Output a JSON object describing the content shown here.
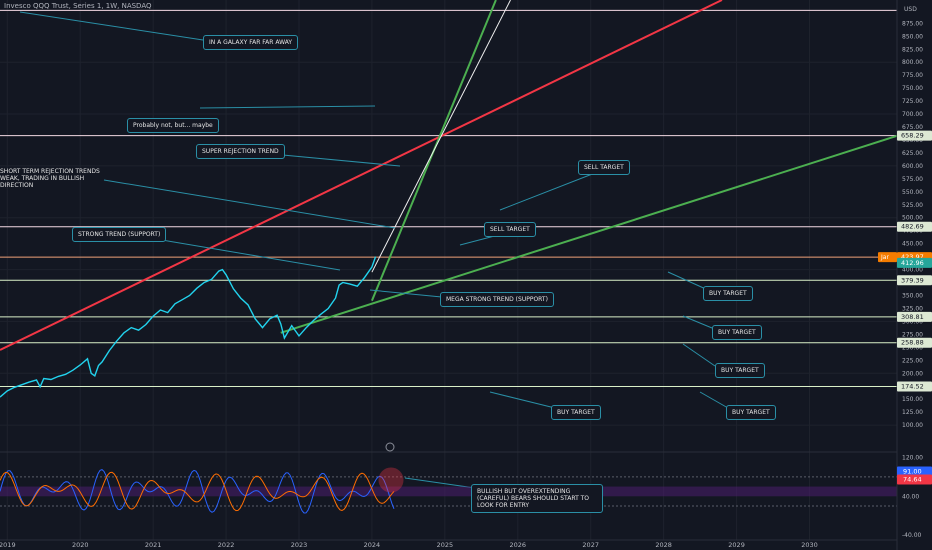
{
  "header": {
    "title": "Invesco QQQ Trust, Series 1, 1W, NASDAQ",
    "currency": "USD"
  },
  "chart_data": {
    "type": "line",
    "title": "Invesco QQQ Trust, Series 1, 1W, NASDAQ",
    "xlabel": "",
    "ylabel": "USD",
    "xlim": [
      2018.9,
      2031.2
    ],
    "ylim": [
      52,
      920
    ],
    "x_ticks": [
      "2019",
      "2020",
      "2021",
      "2022",
      "2023",
      "2024",
      "2025",
      "2026",
      "2027",
      "2028",
      "2029",
      "2030"
    ],
    "y_ticks": [
      100,
      125,
      150,
      175,
      200,
      225,
      250,
      275,
      300,
      325,
      350,
      375,
      400,
      425,
      450,
      475,
      500,
      525,
      550,
      575,
      600,
      625,
      650,
      675,
      700,
      725,
      750,
      775,
      800,
      825,
      850,
      875,
      900
    ],
    "series": [
      {
        "x": [
          2018.9,
          2019.0,
          2019.1,
          2019.2,
          2019.3,
          2019.4,
          2019.45,
          2019.5,
          2019.6,
          2019.7,
          2019.8,
          2019.9,
          2020.0,
          2020.1,
          2020.15,
          2020.2,
          2020.25,
          2020.3,
          2020.4,
          2020.5,
          2020.6,
          2020.7,
          2020.8,
          2020.9,
          2021.0,
          2021.1,
          2021.2,
          2021.3,
          2021.4,
          2021.5,
          2021.6,
          2021.7,
          2021.8,
          2021.9,
          2021.95,
          2022.0,
          2022.1,
          2022.2,
          2022.3,
          2022.4,
          2022.5,
          2022.6,
          2022.7,
          2022.75,
          2022.8,
          2022.9,
          2023.0,
          2023.1,
          2023.2,
          2023.3,
          2023.4,
          2023.5,
          2023.55,
          2023.6,
          2023.7,
          2023.8,
          2023.9,
          2024.0,
          2024.05
        ],
        "values": [
          154,
          166,
          173,
          178,
          183,
          187,
          174,
          190,
          188,
          194,
          198,
          206,
          216,
          228,
          200,
          195,
          215,
          222,
          244,
          262,
          278,
          288,
          283,
          294,
          310,
          322,
          317,
          334,
          342,
          350,
          364,
          375,
          381,
          397,
          400,
          390,
          363,
          345,
          332,
          305,
          288,
          305,
          312,
          295,
          268,
          292,
          272,
          288,
          302,
          314,
          325,
          345,
          370,
          375,
          372,
          368,
          385,
          405,
          425
        ]
      }
    ],
    "current_price_label": "Jar",
    "price_tags": [
      {
        "value": 658.29,
        "text": "658.29"
      },
      {
        "value": 482.69,
        "text": "482.69"
      },
      {
        "value": 423.97,
        "text": "423.97"
      },
      {
        "value": 412.96,
        "text": "412.96"
      },
      {
        "value": 379.39,
        "text": "379.39"
      },
      {
        "value": 308.81,
        "text": "308.81"
      },
      {
        "value": 258.88,
        "text": "258.88"
      },
      {
        "value": 174.52,
        "text": "174.52"
      }
    ],
    "horizontal_levels": [
      {
        "value": 900,
        "color": "#f3d9e3"
      },
      {
        "value": 658.29,
        "color": "#f3d9e3"
      },
      {
        "value": 482.69,
        "color": "#f3d9e3"
      },
      {
        "value": 423.97,
        "color": "#f0a27a"
      },
      {
        "value": 379.39,
        "color": "#d9f0c8"
      },
      {
        "value": 308.81,
        "color": "#d9f0c8"
      },
      {
        "value": 258.88,
        "color": "#d9f0c8"
      },
      {
        "value": 174.52,
        "color": "#d9f0c8"
      }
    ],
    "trendlines": [
      {
        "name": "red-rejection-trendline",
        "x1": 2018.9,
        "y1": 245,
        "x2": 2028.8,
        "y2": 920,
        "color": "#f23645",
        "width": 2
      },
      {
        "name": "green-support-trendline",
        "x1": 2022.75,
        "y1": 278,
        "x2": 2031.2,
        "y2": 658,
        "color": "#4caf50",
        "width": 2
      },
      {
        "name": "super-rejection-trendline-green",
        "x1": 2024.0,
        "y1": 340,
        "x2": 2025.7,
        "y2": 920,
        "color": "#4caf50",
        "width": 2
      },
      {
        "name": "super-rejection-trendline-white",
        "x1": 2024.0,
        "y1": 395,
        "x2": 2025.9,
        "y2": 920,
        "color": "#f0f0f0",
        "width": 1
      }
    ],
    "oscillator": {
      "ylim": [
        -50,
        125
      ],
      "y_ticks": [
        120,
        80,
        40,
        -40
      ],
      "value_tags": [
        "91.00",
        "74.64"
      ],
      "band_low": 40,
      "band_high": 60
    },
    "annotations": [
      {
        "text": "IN A GALAXY FAR FAR AWAY",
        "boxed": true
      },
      {
        "text": "Probably not, but... maybe",
        "boxed": true
      },
      {
        "text": "SUPER REJECTION TREND",
        "boxed": true
      },
      {
        "text": "SHORT TERM REJECTION TRENDS WEAK, TRADING IN BULLISH DIRECTION",
        "boxed": false
      },
      {
        "text": "SELL TARGET",
        "boxed": true
      },
      {
        "text": "SELL TARGET",
        "boxed": true
      },
      {
        "text": "STRONG TREND (SUPPORT)",
        "boxed": true
      },
      {
        "text": "MEGA STRONG TREND (SUPPORT)",
        "boxed": true
      },
      {
        "text": "BUY TARGET",
        "boxed": true
      },
      {
        "text": "BUY TARGET",
        "boxed": true
      },
      {
        "text": "BUY TARGET",
        "boxed": true
      },
      {
        "text": "BUY TARGET",
        "boxed": true
      },
      {
        "text": "BUY TARGET",
        "boxed": true
      },
      {
        "text": "BULLISH BUT OVEREXTENDING (CAREFUL) BEARS SHOULD START TO LOOK FOR ENTRY",
        "boxed": true
      }
    ]
  }
}
